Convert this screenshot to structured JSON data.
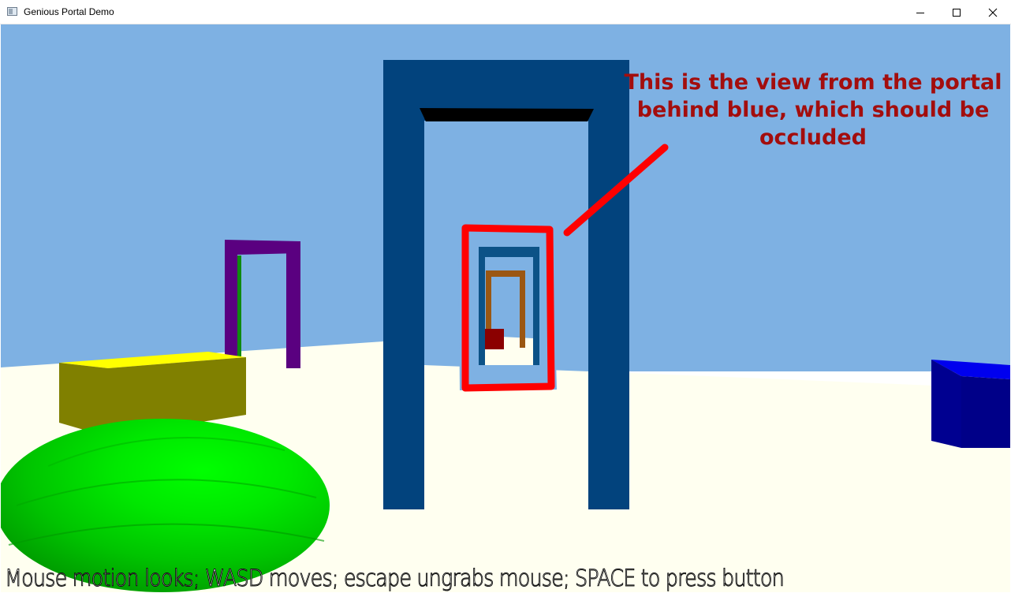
{
  "window": {
    "title": "Genious Portal Demo",
    "icon": "app-window-icon",
    "controls": [
      "minimize-icon",
      "maximize-icon",
      "close-icon"
    ]
  },
  "scene": {
    "colors": {
      "sky": "#7eb1e3",
      "floor": "#fffff0",
      "blue_portal": "#02437d",
      "purple_portal": "#5a0080",
      "orange_portal": "#9b5713",
      "yellow_box": "#808000",
      "green_sphere": "#00d200",
      "blue_box": "#000088",
      "annotation": "#ff0000"
    }
  },
  "annotation": {
    "text": "This is the view from the portal behind blue, which should be occluded"
  },
  "hud": {
    "instructions": "Mouse motion looks; WASD moves; escape ungrabs mouse; SPACE to press button"
  }
}
